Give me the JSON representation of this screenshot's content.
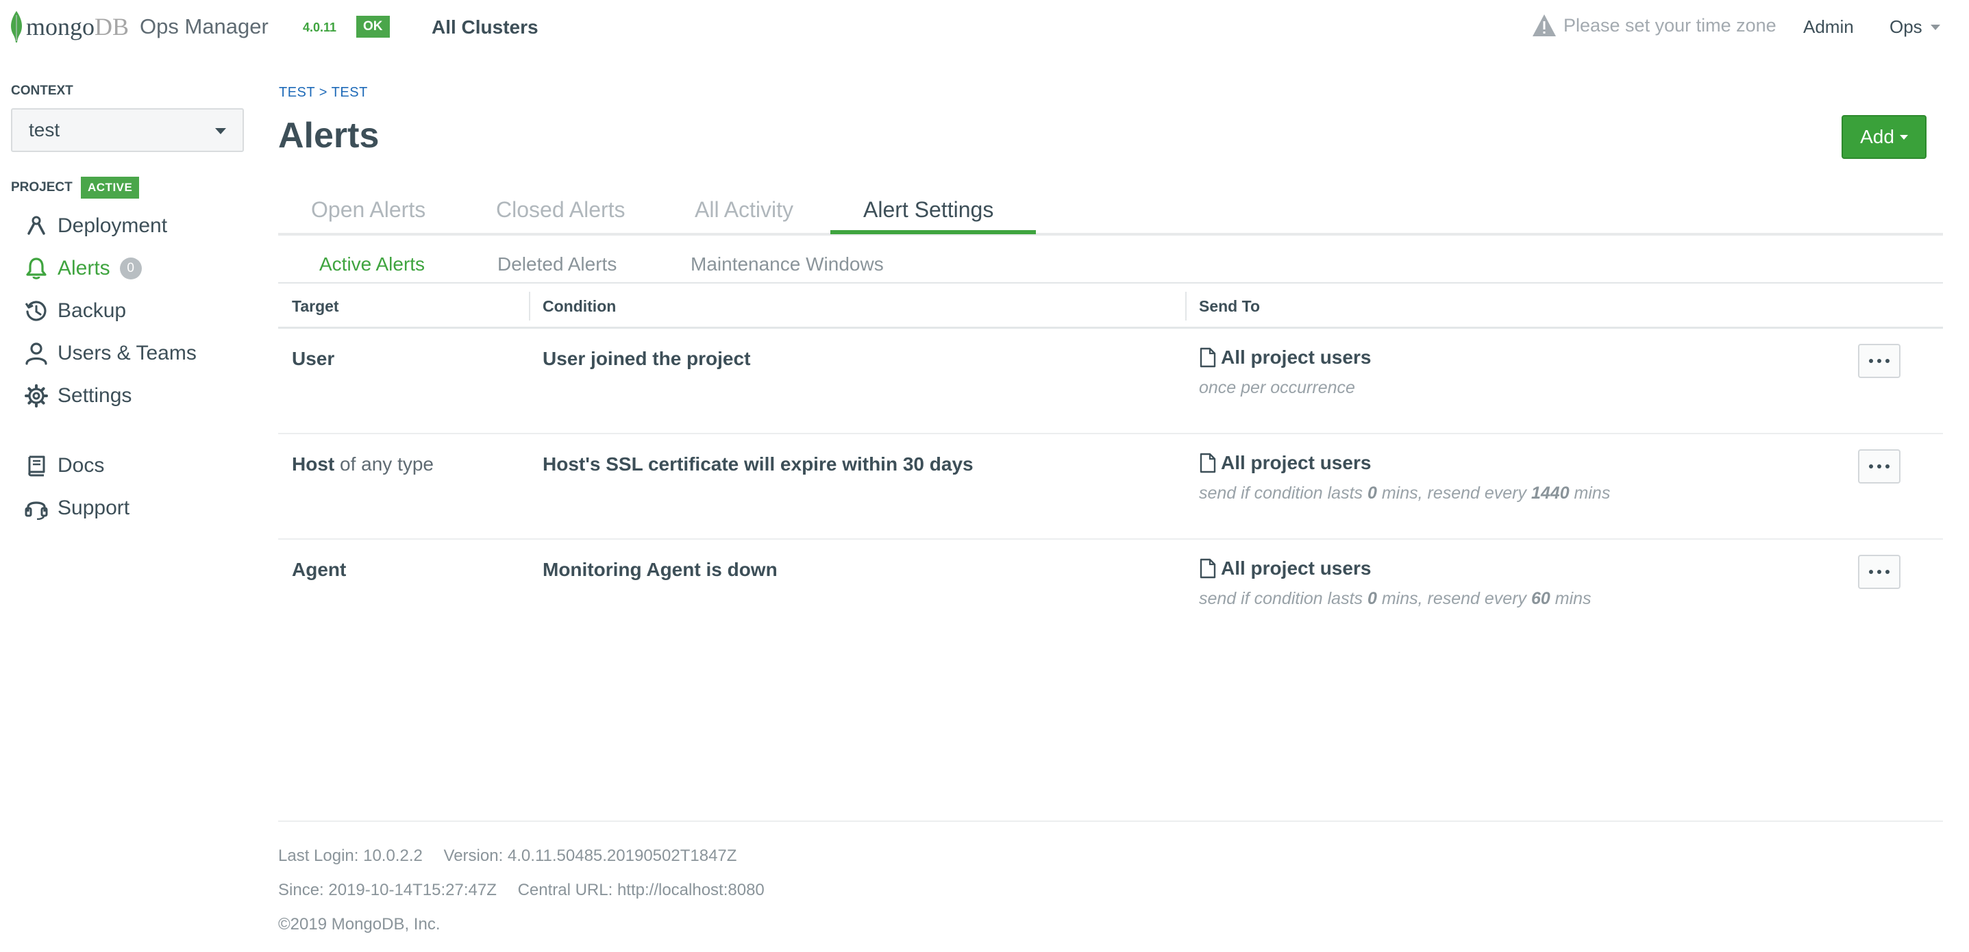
{
  "topbar": {
    "logo_mongo": "mongo",
    "logo_db": "DB",
    "logo_product": "Ops Manager",
    "version": "4.0.11",
    "status": "OK",
    "scope": "All Clusters",
    "timezone_warning": "Please set your time zone",
    "admin": "Admin",
    "org_menu": "Ops"
  },
  "sidebar": {
    "context_label": "CONTEXT",
    "context_value": "test",
    "project_label": "PROJECT",
    "project_status": "ACTIVE",
    "items": [
      {
        "label": "Deployment",
        "icon": "deployment-icon"
      },
      {
        "label": "Alerts",
        "icon": "bell-icon",
        "badge": "0",
        "active": true
      },
      {
        "label": "Backup",
        "icon": "history-icon"
      },
      {
        "label": "Users & Teams",
        "icon": "user-icon"
      },
      {
        "label": "Settings",
        "icon": "gear-icon"
      }
    ],
    "secondary": [
      {
        "label": "Docs",
        "icon": "book-icon"
      },
      {
        "label": "Support",
        "icon": "headset-icon"
      }
    ]
  },
  "main": {
    "breadcrumb": "TEST > TEST",
    "title": "Alerts",
    "add_button": "Add",
    "tabs": [
      "Open Alerts",
      "Closed Alerts",
      "All Activity",
      "Alert Settings"
    ],
    "selected_tab": "Alert Settings",
    "subtabs": [
      "Active Alerts",
      "Deleted Alerts",
      "Maintenance Windows"
    ],
    "selected_subtab": "Active Alerts",
    "columns": [
      "Target",
      "Condition",
      "Send To"
    ],
    "rows": [
      {
        "target": "User",
        "target_suffix": "",
        "condition": "User joined the project",
        "send_to": "All project users",
        "frequency": {
          "pre": "once per occurrence",
          "lasts": "",
          "mid": "",
          "every": "",
          "post": ""
        }
      },
      {
        "target": "Host",
        "target_suffix": "of any type",
        "condition": "Host's SSL certificate will expire within 30 days",
        "send_to": "All project users",
        "frequency": {
          "pre": "send if condition lasts ",
          "lasts": "0",
          "mid": " mins, resend every ",
          "every": "1440",
          "post": " mins"
        }
      },
      {
        "target": "Agent",
        "target_suffix": "",
        "condition": "Monitoring Agent is down",
        "send_to": "All project users",
        "frequency": {
          "pre": "send if condition lasts ",
          "lasts": "0",
          "mid": " mins, resend every ",
          "every": "60",
          "post": " mins"
        }
      }
    ]
  },
  "footer": {
    "last_login_label": "Last Login:",
    "last_login": "10.0.2.2",
    "version_label": "Version:",
    "version": "4.0.11.50485.20190502T1847Z",
    "since_label": "Since:",
    "since": "2019-10-14T15:27:47Z",
    "central_url_label": "Central URL:",
    "central_url": "http://localhost:8080",
    "copyright": "©2019 MongoDB, Inc."
  },
  "colors": {
    "brand_green": "#3fa43f",
    "text": "#3d4f58",
    "muted": "#8a949a",
    "link_blue": "#1e6ab8"
  }
}
